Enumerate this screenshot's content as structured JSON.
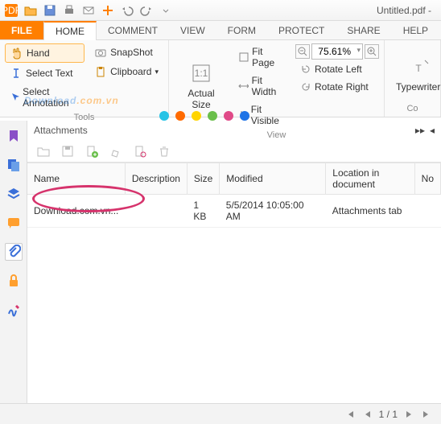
{
  "title": "Untitled.pdf -",
  "tabs": {
    "file": "FILE",
    "home": "HOME",
    "comment": "COMMENT",
    "view": "VIEW",
    "form": "FORM",
    "protect": "PROTECT",
    "share": "SHARE",
    "help": "HELP"
  },
  "ribbon": {
    "hand": "Hand",
    "select_text": "Select Text",
    "select_annotation": "Select Annotation",
    "snapshot": "SnapShot",
    "clipboard": "Clipboard",
    "actual_size": "Actual Size",
    "fit_page": "Fit Page",
    "fit_width": "Fit Width",
    "fit_visible": "Fit Visible",
    "zoom_value": "75.61%",
    "rotate_left": "Rotate Left",
    "rotate_right": "Rotate Right",
    "typewriter": "Typewriter",
    "group_tools": "Tools",
    "group_view": "View",
    "group_co": "Co"
  },
  "panel": {
    "title": "Attachments",
    "cols": {
      "name": "Name",
      "description": "Description",
      "size": "Size",
      "modified": "Modified",
      "location": "Location in document",
      "no": "No"
    },
    "rows": [
      {
        "name": "Download.com.vn...",
        "description": "",
        "size": "1 KB",
        "modified": "5/5/2014 10:05:00 AM",
        "location": "Attachments tab"
      }
    ]
  },
  "status": {
    "page": "1 / 1"
  },
  "watermark": {
    "a": "Download",
    "b": ".com.vn"
  },
  "dot_colors": [
    "#27c3e6",
    "#ff6a00",
    "#ffd400",
    "#6abf4b",
    "#e04a88",
    "#1e73e6"
  ]
}
